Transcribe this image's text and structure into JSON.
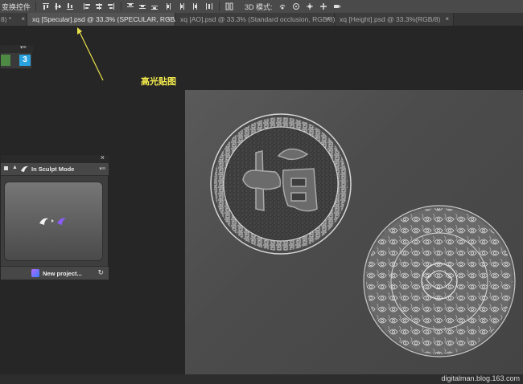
{
  "options_bar": {
    "label_left": "变换控件",
    "label_3d": "3D 模式:"
  },
  "tabs": [
    {
      "label": "8) *",
      "active": false
    },
    {
      "label": "xq [Specular].psd @ 33.3% (SPECULAR, RGB/8)",
      "active": true
    },
    {
      "label": "xq [AO].psd @ 33.3% (Standard occlusion, RGB/8) *",
      "active": false
    },
    {
      "label": "xq [Height].psd @ 33.3%(RGB/8)",
      "active": false
    }
  ],
  "annotation": {
    "text": "高光贴图"
  },
  "coat_panel": {
    "mode": "In Sculpt Mode",
    "new_project": "New project..."
  },
  "mini_panel": {
    "logo": "3"
  },
  "watermark": "digitalman.blog.163.com",
  "colors": {
    "annotation": "#f2e94c",
    "coat_accent": "#7a5cff"
  }
}
